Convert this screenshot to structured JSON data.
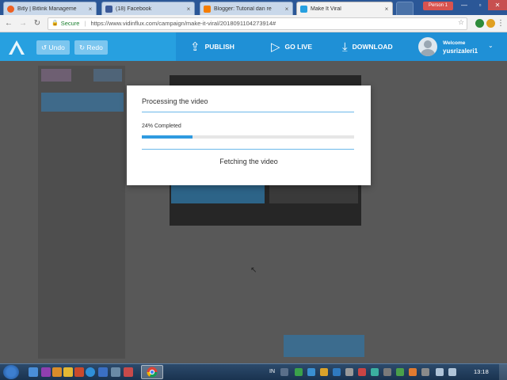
{
  "browser": {
    "tabs": [
      {
        "label": "Bitly | Bitlink Manageme",
        "favicon_color": "#ee6123",
        "active": false
      },
      {
        "label": "(18) Facebook",
        "favicon_color": "#3b5998",
        "active": false
      },
      {
        "label": "Blogger: Tutorial dan re",
        "favicon_color": "#f57d00",
        "active": false
      },
      {
        "label": "Make It Viral",
        "favicon_color": "#27a0e0",
        "active": true
      }
    ],
    "tab_close_glyph": "×",
    "person_badge": "Person 1",
    "secure_label": "Secure",
    "url": "https://www.vidinflux.com/campaign/make-it-viral/2018091104273914#"
  },
  "app": {
    "undo_label": "Undo",
    "redo_label": "Redo",
    "actions": [
      {
        "label": "PUBLISH",
        "icon": "upload-icon"
      },
      {
        "label": "GO LIVE",
        "icon": "play-icon"
      },
      {
        "label": "DOWNLOAD",
        "icon": "download-icon"
      }
    ],
    "welcome_label": "Welcome",
    "username": "yusrizaleri1",
    "brand_color": "#27a0e0",
    "action_bar_color": "#1f90d6"
  },
  "modal": {
    "title": "Processing the video",
    "progress_text": "24% Completed",
    "progress_fraction": 0.24,
    "status": "Fetching the video"
  },
  "taskbar": {
    "language": "IN",
    "clock": "13:18"
  }
}
